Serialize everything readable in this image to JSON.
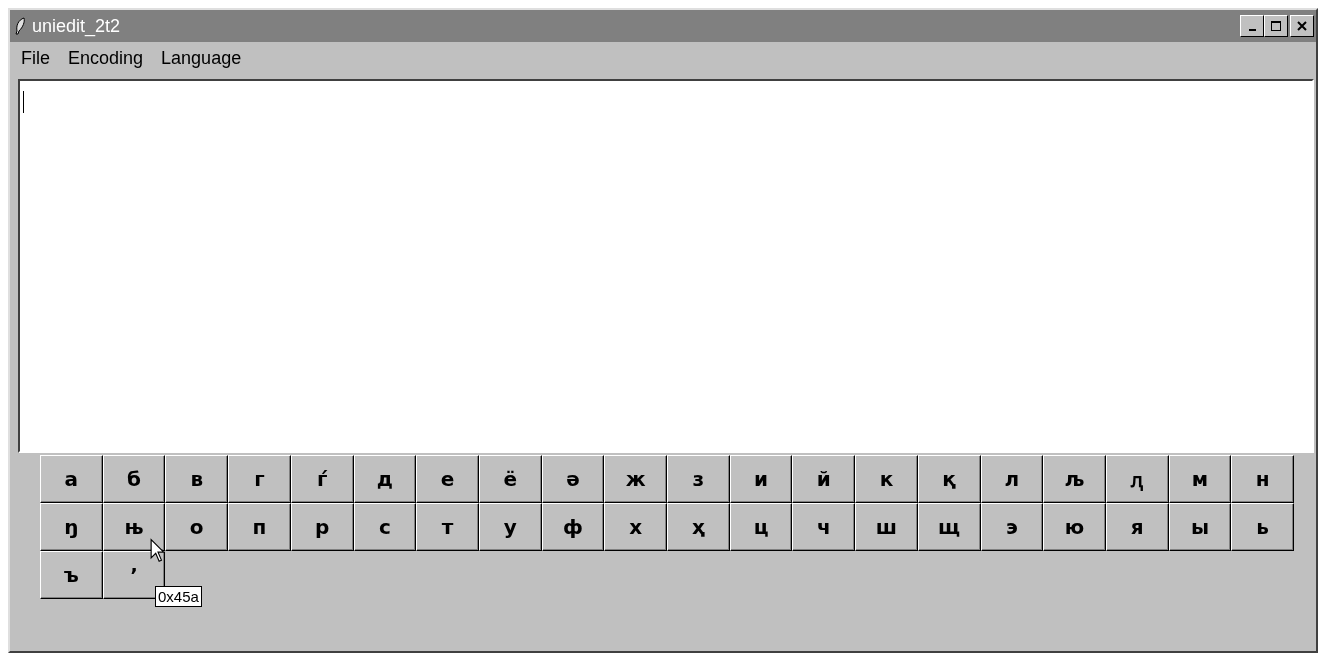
{
  "window": {
    "title": "uniedit_2t2"
  },
  "menu": [
    "File",
    "Encoding",
    "Language"
  ],
  "keys": [
    "а",
    "б",
    "в",
    "г",
    "ѓ",
    "д",
    "е",
    "ё",
    "ә",
    "ж",
    "з",
    "и",
    "й",
    "к",
    "қ",
    "л",
    "љ",
    "ԯ",
    "м",
    "н",
    "ŋ",
    "њ",
    "о",
    "п",
    "р",
    "с",
    "т",
    "у",
    "ф",
    "х",
    "ҳ",
    "ц",
    "ч",
    "ш",
    "щ",
    "э",
    "ю",
    "я",
    "ы",
    "ь",
    "ъ",
    "ʼ"
  ],
  "tooltip": {
    "text": "0x45a"
  }
}
